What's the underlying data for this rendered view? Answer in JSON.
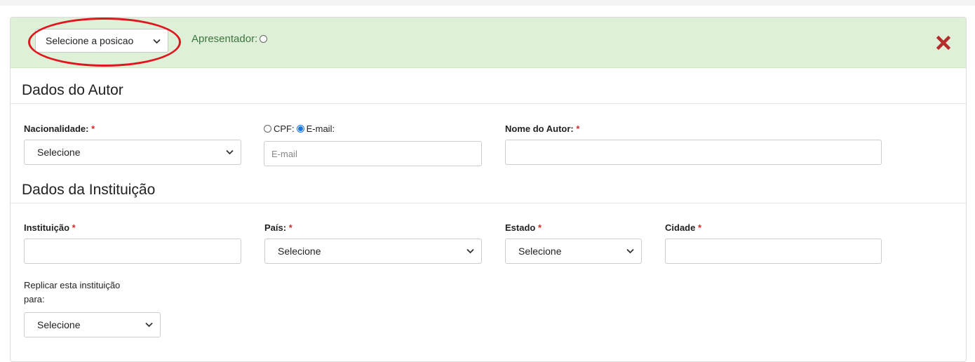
{
  "header": {
    "position_select": {
      "selected": "Selecione a posicao"
    },
    "presenter_label": "Apresentador:",
    "close_color": "#b52a2a"
  },
  "author": {
    "section_title": "Dados do Autor",
    "nationality": {
      "label": "Nacionalidade:",
      "required_mark": "*",
      "selected": "Selecione"
    },
    "doc_type": {
      "cpf_label": "CPF:",
      "email_label": "E-mail:",
      "selected": "E-mail"
    },
    "email_input": {
      "placeholder": "E-mail",
      "value": ""
    },
    "author_name": {
      "label": "Nome do Autor:",
      "required_mark": "*",
      "value": ""
    }
  },
  "institution": {
    "section_title": "Dados da Instituição",
    "institution": {
      "label": "Instituição",
      "required_mark": "*",
      "value": ""
    },
    "country": {
      "label": "País:",
      "required_mark": "*",
      "selected": "Selecione"
    },
    "state": {
      "label": "Estado",
      "required_mark": "*",
      "selected": "Selecione"
    },
    "city": {
      "label": "Cidade",
      "required_mark": "*",
      "value": ""
    },
    "replicate": {
      "label_line1": "Replicar esta instituição",
      "label_line2": "para:",
      "selected": "Selecione"
    }
  },
  "colors": {
    "header_bg": "#dff0d8",
    "header_text": "#3c763d",
    "required": "#c9302c",
    "highlight_ring": "#e0161e",
    "radio_checked": "#1a73e8"
  }
}
